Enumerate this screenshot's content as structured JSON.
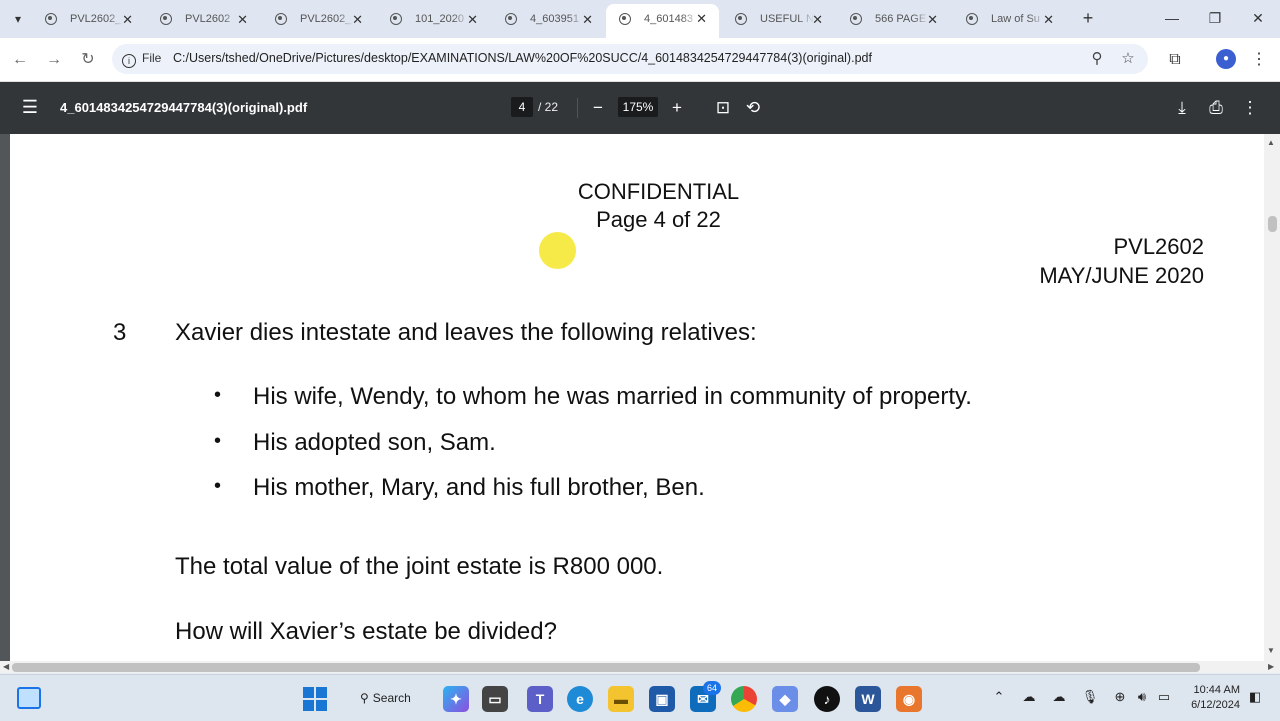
{
  "tabs": [
    {
      "label": "PVL2602_"
    },
    {
      "label": "PVL2602"
    },
    {
      "label": "PVL2602_"
    },
    {
      "label": "101_2020"
    },
    {
      "label": "4_603951"
    },
    {
      "label": "4_601483",
      "active": true
    },
    {
      "label": "USEFUL N"
    },
    {
      "label": "566 PAGE"
    },
    {
      "label": "Law of Su"
    }
  ],
  "address_bar": {
    "site_info": "File",
    "url": "C:/Users/tshed/OneDrive/Pictures/desktop/EXAMINATIONS/LAW%20OF%20SUCC/4_6014834254729447784(3)(original).pdf"
  },
  "pdf_toolbar": {
    "filename": "4_6014834254729447784(3)(original).pdf",
    "current_page": "4",
    "total_pages": "/ 22",
    "zoom": "175%"
  },
  "document": {
    "header_line1": "CONFIDENTIAL",
    "header_line2": "Page 4 of 22",
    "course_code": "PVL2602",
    "session": "MAY/JUNE 2020",
    "question_number": "3",
    "question_intro": "Xavier dies intestate and leaves the following relatives:",
    "bullets": [
      "His wife, Wendy, to whom he was married in community of property.",
      "His adopted son, Sam.",
      "His mother, Mary, and his full brother, Ben."
    ],
    "estate_value": "The total value of the joint estate is R800 000.",
    "question": "How will Xavier’s estate be divided?"
  },
  "taskbar": {
    "search_label": "Search",
    "mail_badge": "64",
    "time": "10:44 AM",
    "date": "6/12/2024"
  },
  "colors": {
    "pdf_toolbar_bg": "#323639",
    "tabstrip_bg": "#dfe6f1",
    "cursor_highlight": "#f5e628"
  }
}
